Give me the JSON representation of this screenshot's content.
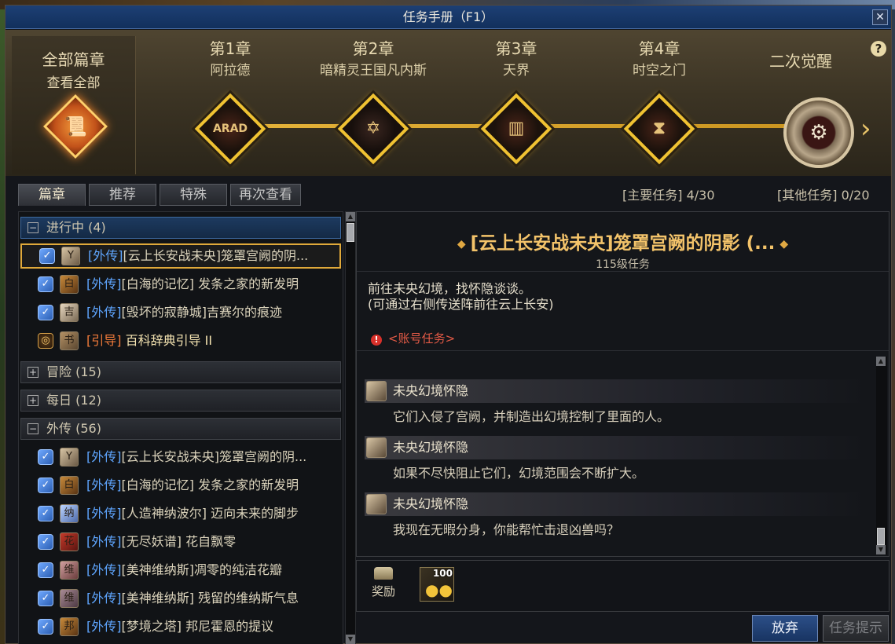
{
  "window": {
    "title": "任务手册（F1）",
    "close_symbol": "✕"
  },
  "banner": {
    "all_chapters": {
      "title": "全部篇章",
      "subtitle": "查看全部",
      "icon": "scroll-icon"
    },
    "chapters": [
      {
        "name": "第1章",
        "subtitle": "阿拉德",
        "emblem": "ARAD"
      },
      {
        "name": "第2章",
        "subtitle": "暗精灵王国凡内斯",
        "emblem": "✡"
      },
      {
        "name": "第3章",
        "subtitle": "天界",
        "emblem": "▥"
      },
      {
        "name": "第4章",
        "subtitle": "时空之门",
        "emblem": "⧗"
      },
      {
        "name": "二次觉醒",
        "subtitle": "",
        "emblem": "⚙"
      }
    ],
    "help_symbol": "?",
    "next_symbol": "›"
  },
  "tabs": [
    {
      "label": "篇章",
      "active": true
    },
    {
      "label": "推荐",
      "active": false
    },
    {
      "label": "特殊",
      "active": false
    },
    {
      "label": "再次查看",
      "active": false
    }
  ],
  "counts": {
    "main": "[主要任务] 4/30",
    "other": "[其他任务] 0/20"
  },
  "list": {
    "groups": {
      "in_progress": {
        "toggle": "−",
        "label": "进行中 (4)"
      },
      "adventure": {
        "toggle": "+",
        "label": "冒险 (15)"
      },
      "daily": {
        "toggle": "+",
        "label": "每日 (12)"
      },
      "side": {
        "toggle": "−",
        "label": "外传 (56)"
      }
    },
    "in_progress_rows": [
      {
        "tag": "[外传]",
        "title": "[云上长安战未央]笼罩宫阙的阴...",
        "avatar": "Y"
      },
      {
        "tag": "[外传]",
        "title": "[白海的记忆] 发条之家的新发明",
        "avatar": "白"
      },
      {
        "tag": "[外传]",
        "title": "[毁坏的寂静城]吉赛尔的痕迹",
        "avatar": "吉"
      },
      {
        "tag": "[引导]",
        "title": "百科辞典引导 II",
        "avatar": "书"
      }
    ],
    "side_rows": [
      {
        "tag": "[外传]",
        "title": "[云上长安战未央]笼罩宫阙的阴...",
        "avatar": "Y"
      },
      {
        "tag": "[外传]",
        "title": "[白海的记忆] 发条之家的新发明",
        "avatar": "白"
      },
      {
        "tag": "[外传]",
        "title": "[人造神纳波尔] 迈向未来的脚步",
        "avatar": "纳"
      },
      {
        "tag": "[外传]",
        "title": "[无尽妖谱] 花自飘零",
        "avatar": "花"
      },
      {
        "tag": "[外传]",
        "title": "[美神维纳斯]凋零的纯洁花瓣",
        "avatar": "维"
      },
      {
        "tag": "[外传]",
        "title": "[美神维纳斯] 残留的维纳斯气息",
        "avatar": "维"
      },
      {
        "tag": "[外传]",
        "title": "[梦境之塔] 邦尼霍恩的提议",
        "avatar": "邦"
      }
    ],
    "check_symbol": "✓"
  },
  "detail": {
    "title": "[云上长安战未央]笼罩宫阙的阴影 (...",
    "title_ornament": "◆",
    "level": "115级任务",
    "desc_line1": "前往未央幻境，找怀隐谈谈。",
    "desc_line2": "(可通过右侧传送阵前往云上长安)",
    "account_tag": "<账号任务>",
    "warn_symbol": "!",
    "dialogs": [
      {
        "speaker": "未央幻境怀隐",
        "text": "它们入侵了宫阙，并制造出幻境控制了里面的人。"
      },
      {
        "speaker": "未央幻境怀隐",
        "text": "如果不尽快阻止它们，幻境范围会不断扩大。"
      },
      {
        "speaker": "未央幻境怀隐",
        "text": "我现在无暇分身，你能帮忙击退凶兽吗？"
      }
    ]
  },
  "reward": {
    "label": "奖励",
    "item_qty": "100",
    "item_icon": "gold-coins-icon"
  },
  "buttons": {
    "abandon": "放弃",
    "hint": "任务提示"
  },
  "colors": {
    "accent_gold": "#f0c232",
    "title_bar": "#1d3f74",
    "quest_tag_blue": "#5fa6ff",
    "guide_tag_orange": "#f07a3a",
    "account_red": "#e35a46"
  }
}
